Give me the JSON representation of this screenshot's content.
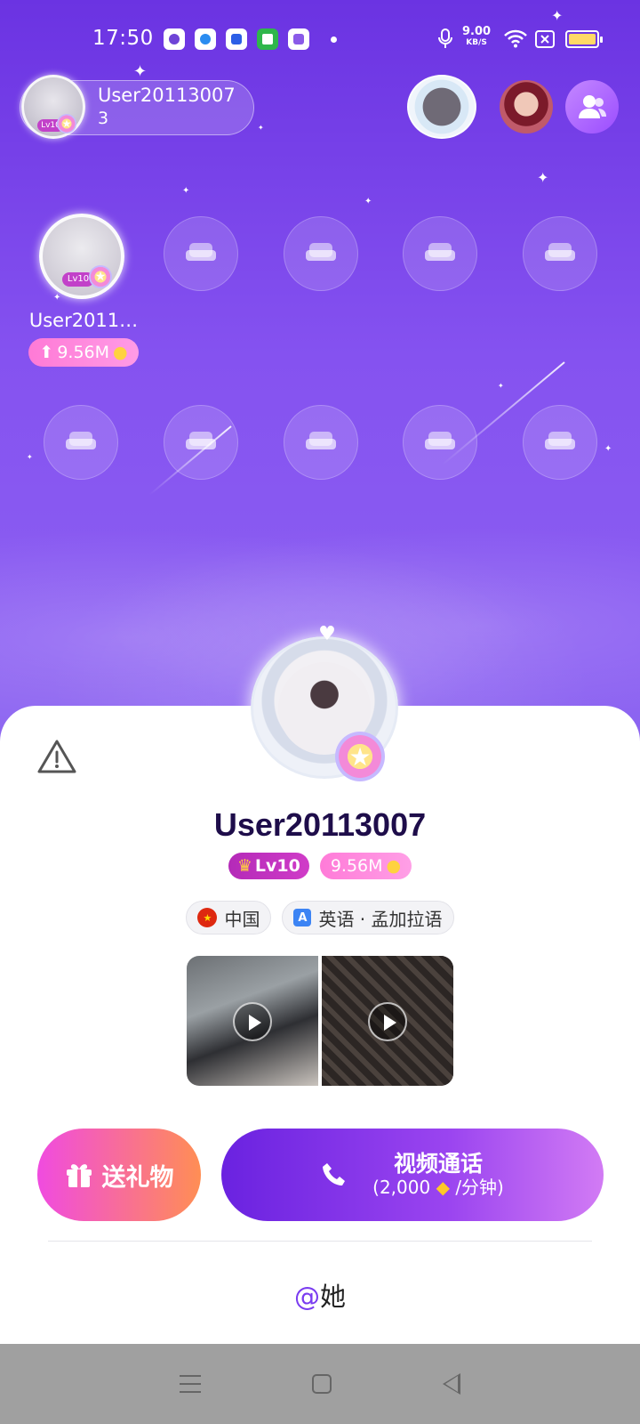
{
  "status_bar": {
    "time": "17:50",
    "net_speed": "9.00",
    "net_unit": "KB/S",
    "icons": [
      "app-icon-1",
      "app-icon-2",
      "baidu-icon",
      "shield-icon",
      "app-icon-5",
      "mic-icon",
      "wifi-icon",
      "sim-off-icon",
      "battery-icon"
    ]
  },
  "room_host": {
    "name": "User20113007",
    "id": "3",
    "level_badge": "Lv10"
  },
  "seats": {
    "occupied_name": "User2011…",
    "occupied_score": "9.56M",
    "occupied_level": "Lv10",
    "empty_seat_icon": "sofa-icon"
  },
  "profile": {
    "name": "User20113007",
    "level": "Lv10",
    "score": "9.56M",
    "country": "中国",
    "languages": "英语 · 孟加拉语",
    "lang_icon_letter": "A",
    "videos": [
      {
        "label": "video-thumbnail-1"
      },
      {
        "label": "video-thumbnail-2"
      }
    ]
  },
  "actions": {
    "gift_label": "送礼物",
    "call_title": "视频通话",
    "call_price_prefix": "(2,000",
    "call_price_suffix": "/分钟)",
    "mention_symbol": "@",
    "mention_text": "她"
  },
  "colors": {
    "accent": "#7a3cf0",
    "gift_gradient_start": "#f04be0",
    "gift_gradient_end": "#ff8e54",
    "call_gradient_start": "#6a22e0",
    "call_gradient_end": "#d27bf4",
    "name_color": "#1e0d4a"
  }
}
